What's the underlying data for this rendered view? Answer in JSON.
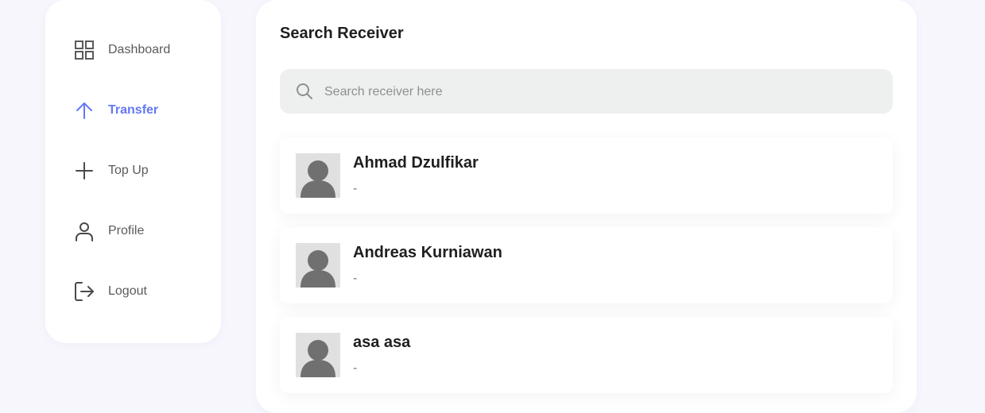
{
  "sidebar": {
    "items": [
      {
        "label": "Dashboard",
        "icon": "grid-icon",
        "active": false
      },
      {
        "label": "Transfer",
        "icon": "arrow-up-icon",
        "active": true
      },
      {
        "label": "Top Up",
        "icon": "plus-icon",
        "active": false
      },
      {
        "label": "Profile",
        "icon": "user-icon",
        "active": false
      },
      {
        "label": "Logout",
        "icon": "logout-icon",
        "active": false
      }
    ]
  },
  "main": {
    "title": "Search Receiver",
    "search": {
      "placeholder": "Search receiver here",
      "value": ""
    },
    "receivers": [
      {
        "name": "Ahmad Dzulfikar",
        "phone": "-"
      },
      {
        "name": "Andreas Kurniawan",
        "phone": "-"
      },
      {
        "name": "asa asa",
        "phone": "-"
      }
    ]
  },
  "colors": {
    "accent": "#6379f4",
    "background": "#f7f6fd",
    "panel": "#ffffff",
    "search_bg": "#eeefef",
    "avatar_fg": "#707070",
    "avatar_bg": "#e0e0e0"
  }
}
